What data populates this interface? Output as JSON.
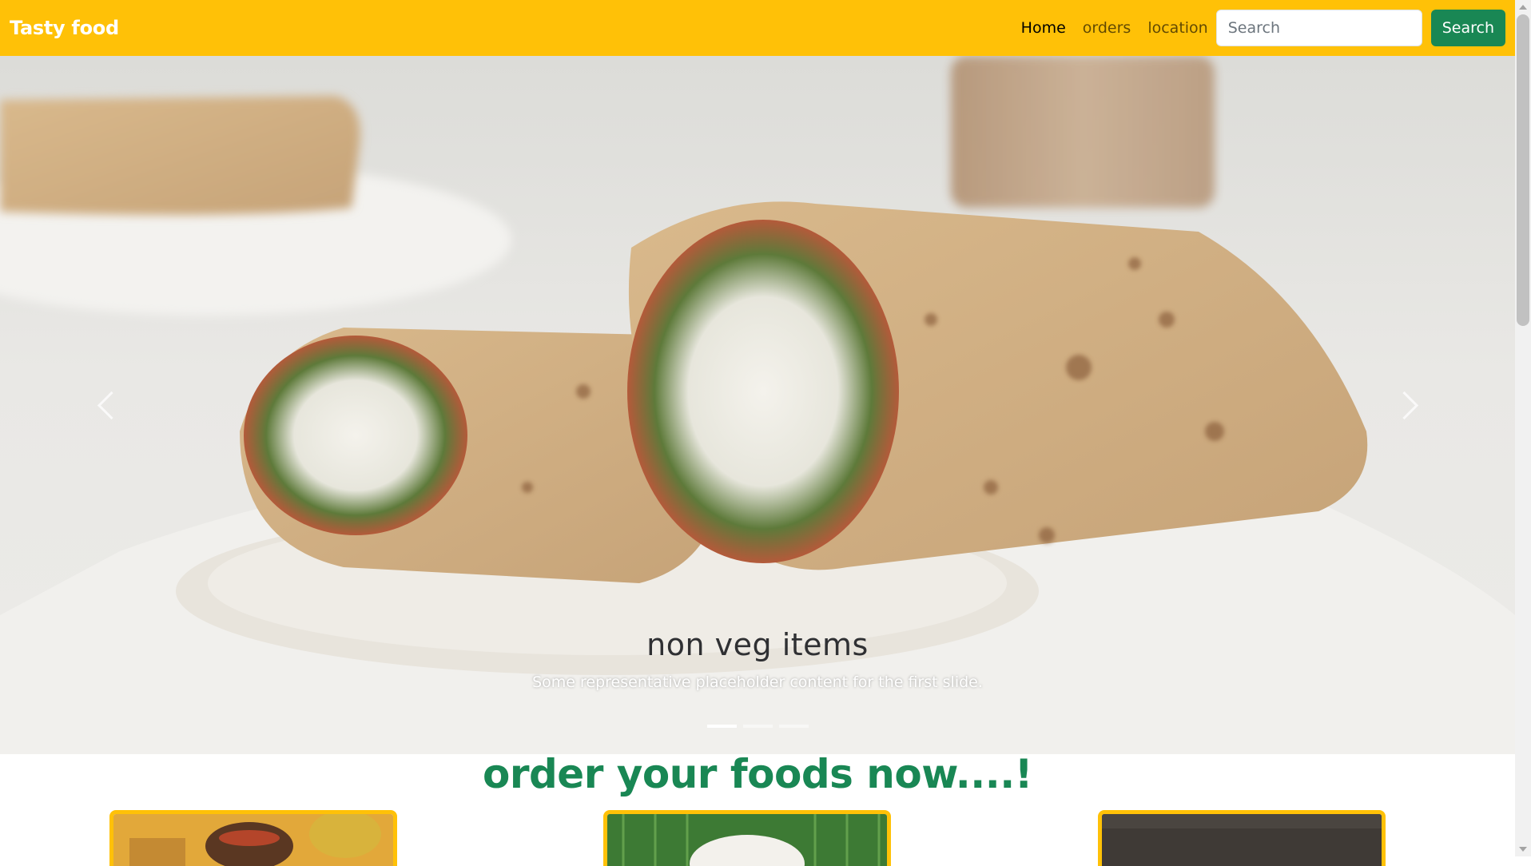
{
  "navbar": {
    "brand": "Tasty food",
    "links": [
      {
        "label": "Home",
        "active": true
      },
      {
        "label": "orders",
        "active": false
      },
      {
        "label": "location",
        "active": false
      }
    ],
    "search_placeholder": "Search",
    "search_button": "Search"
  },
  "carousel": {
    "caption_title": "non veg items",
    "caption_text": "Some representative placeholder content for the first slide.",
    "active_slide": 1,
    "slide_count": 3
  },
  "section": {
    "title": "order your foods now....!"
  },
  "colors": {
    "navbar_bg": "#ffc107",
    "accent_green": "#198754",
    "card_border": "#ffc107"
  }
}
